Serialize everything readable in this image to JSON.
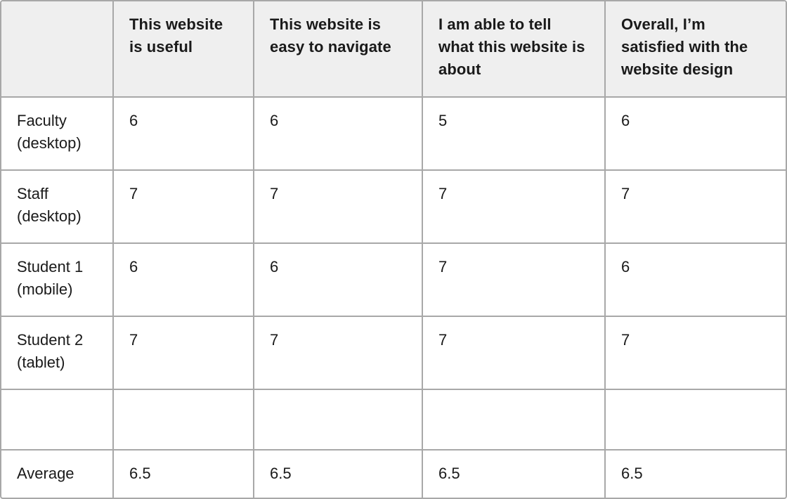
{
  "table": {
    "headers": [
      "",
      "This website is useful",
      "This website is easy to navigate",
      "I am able to tell what this website is about",
      "Overall, I’m satisfied with the website design"
    ],
    "rows": [
      {
        "label": "Faculty (desktop)",
        "values": [
          "6",
          "6",
          "5",
          "6"
        ]
      },
      {
        "label": "Staff (desktop)",
        "values": [
          "7",
          "7",
          "7",
          "7"
        ]
      },
      {
        "label": "Student 1 (mobile)",
        "values": [
          "6",
          "6",
          "7",
          "6"
        ]
      },
      {
        "label": "Student 2 (tablet)",
        "values": [
          "7",
          "7",
          "7",
          "7"
        ]
      },
      {
        "label": "",
        "values": [
          "",
          "",
          "",
          ""
        ]
      },
      {
        "label": "Average",
        "values": [
          "6.5",
          "6.5",
          "6.5",
          "6.5"
        ]
      }
    ]
  },
  "colors": {
    "header_background": "#efefef",
    "border": "#a8a8a8",
    "text": "#1a1a1a"
  }
}
